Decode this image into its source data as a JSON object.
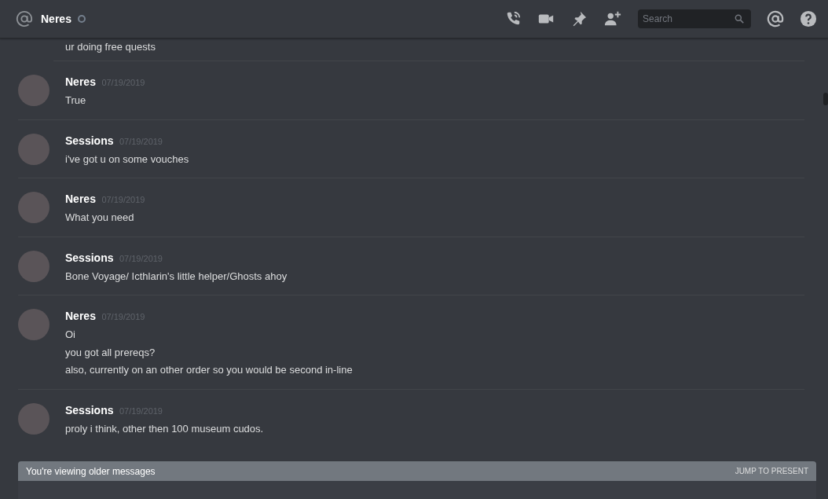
{
  "header": {
    "channel_name": "Neres",
    "search": {
      "placeholder": "Search"
    }
  },
  "partial_message": {
    "lines": [
      "ur doing free quests"
    ]
  },
  "messages": [
    {
      "author": "Neres",
      "timestamp": "07/19/2019",
      "lines": [
        "True"
      ]
    },
    {
      "author": "Sessions",
      "timestamp": "07/19/2019",
      "lines": [
        "i've got u on some vouches"
      ]
    },
    {
      "author": "Neres",
      "timestamp": "07/19/2019",
      "lines": [
        "What you need"
      ]
    },
    {
      "author": "Sessions",
      "timestamp": "07/19/2019",
      "lines": [
        "Bone Voyage/ Icthlarin's little helper/Ghosts ahoy"
      ]
    },
    {
      "author": "Neres",
      "timestamp": "07/19/2019",
      "lines": [
        "Oi",
        "you got all prereqs?",
        "also, currently on an other order so you would be second in-line"
      ]
    },
    {
      "author": "Sessions",
      "timestamp": "07/19/2019",
      "lines": [
        "proly i think, other then 100 museum cudos."
      ]
    }
  ],
  "older_bar": {
    "text": "You're viewing older messages",
    "action": "JUMP TO PRESENT"
  }
}
